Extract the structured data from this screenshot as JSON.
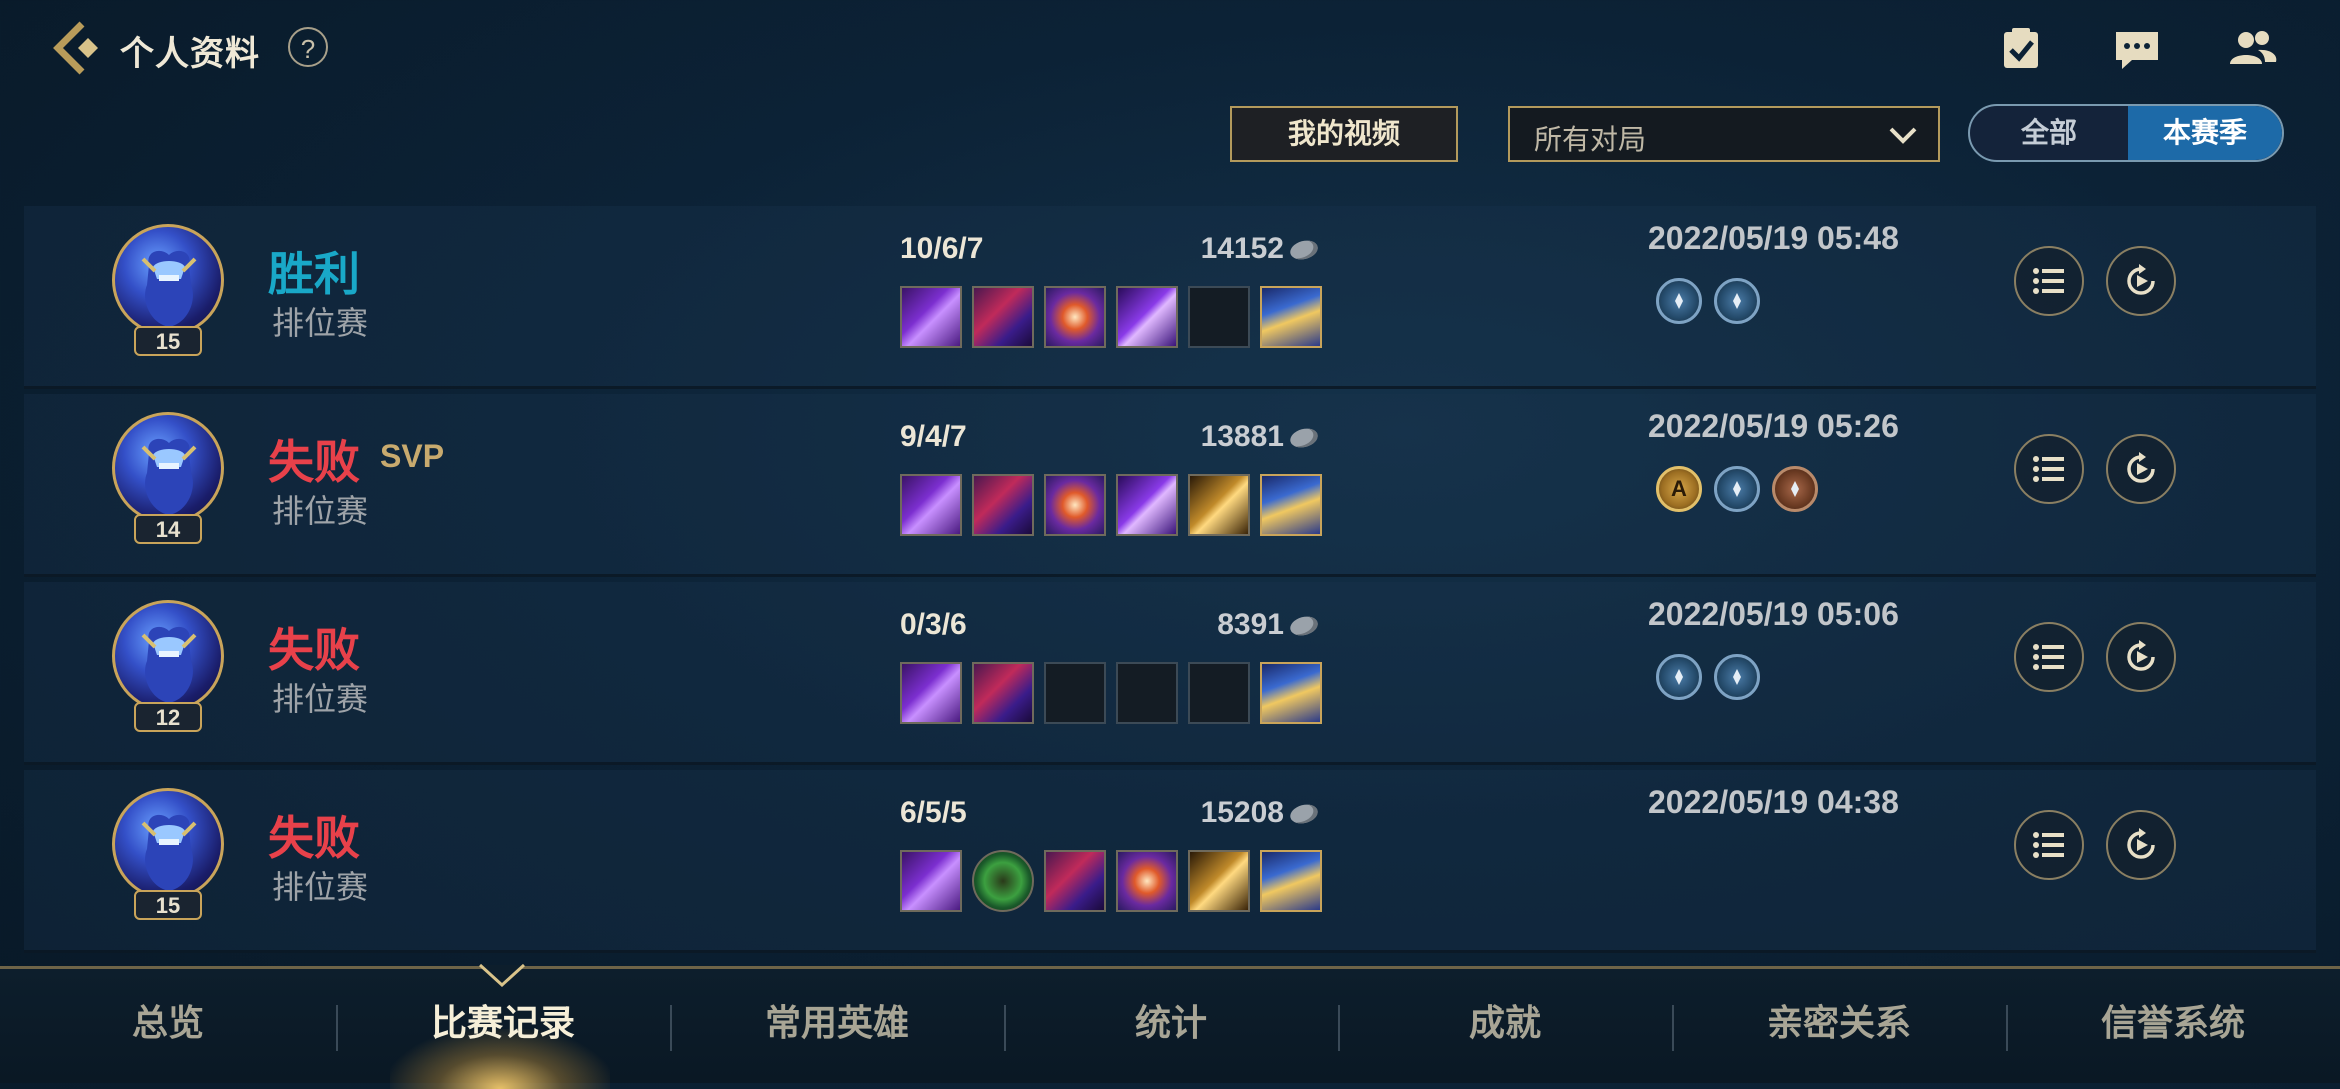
{
  "header": {
    "title": "个人资料",
    "help_label": "?",
    "icons": [
      "checklist-icon",
      "chat-icon",
      "friends-icon"
    ]
  },
  "filters": {
    "my_video_label": "我的视频",
    "match_filter_value": "所有对局",
    "toggle_options": [
      "全部",
      "本赛季"
    ],
    "toggle_selected": "本赛季"
  },
  "matches": [
    {
      "level": "15",
      "result": "胜利",
      "result_type": "win",
      "svp": "",
      "mode": "排位赛",
      "kda": "10/6/7",
      "gold": "14152",
      "items": [
        "purple-blade",
        "purple-cloak",
        "orb-burst",
        "purple-cube",
        "empty",
        "trinket"
      ],
      "datetime": "2022/05/19 05:48",
      "runes": [
        "blue",
        "blue"
      ]
    },
    {
      "level": "14",
      "result": "失败",
      "result_type": "loss",
      "svp": "SVP",
      "mode": "排位赛",
      "kda": "9/4/7",
      "gold": "13881",
      "items": [
        "purple-blade",
        "purple-cloak",
        "orb-burst",
        "purple-cube",
        "gold-hammer",
        "trinket"
      ],
      "datetime": "2022/05/19 05:26",
      "runes": [
        "gold",
        "blue",
        "bronze"
      ],
      "rune_text": "A"
    },
    {
      "level": "12",
      "result": "失败",
      "result_type": "loss",
      "svp": "",
      "mode": "排位赛",
      "kda": "0/3/6",
      "gold": "8391",
      "items": [
        "purple-blade",
        "purple-cloak",
        "empty",
        "empty",
        "empty",
        "trinket"
      ],
      "datetime": "2022/05/19 05:06",
      "runes": [
        "blue",
        "blue"
      ]
    },
    {
      "level": "15",
      "result": "失败",
      "result_type": "loss",
      "svp": "",
      "mode": "排位赛",
      "kda": "6/5/5",
      "gold": "15208",
      "items": [
        "purple-blade",
        "green-compass",
        "purple-cloak",
        "orb-burst",
        "gold-hammer",
        "trinket"
      ],
      "datetime": "2022/05/19 04:38",
      "runes": []
    }
  ],
  "nav": {
    "items": [
      "总览",
      "比赛记录",
      "常用英雄",
      "统计",
      "成就",
      "亲密关系",
      "信誉系统"
    ],
    "active": "比赛记录"
  },
  "colors": {
    "win": "#19a8c8",
    "loss": "#e8414a",
    "accent_gold": "#c9a45a",
    "toggle_active": "#1d6aa8"
  }
}
